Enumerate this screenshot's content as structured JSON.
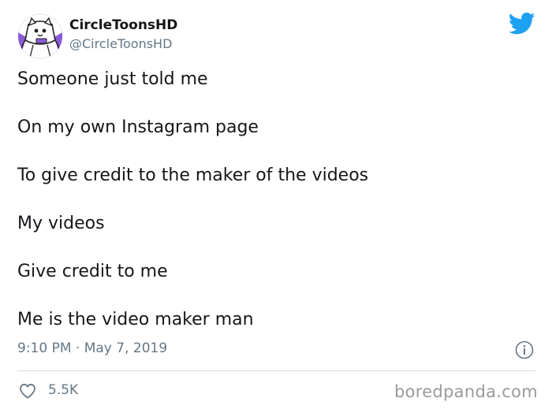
{
  "author": {
    "display_name": "CircleToonsHD",
    "handle": "@CircleToonsHD",
    "avatar_icon": "ghost-cat-avatar-icon"
  },
  "tweet": {
    "lines": [
      "Someone just told me",
      "On my own Instagram page",
      "To give credit to the maker of the videos",
      "My videos",
      "Give credit to me",
      "Me is the video maker man"
    ],
    "timestamp": "9:10 PM · May 7, 2019"
  },
  "stats": {
    "likes": "5.5K"
  },
  "watermark": "boredpanda.com",
  "colors": {
    "twitter_blue": "#1da1f2",
    "secondary_text": "#657786",
    "avatar_purple": "#8a5bd6"
  },
  "icons": {
    "brand": "twitter-bird-icon",
    "info": "info-icon",
    "like": "heart-icon"
  }
}
